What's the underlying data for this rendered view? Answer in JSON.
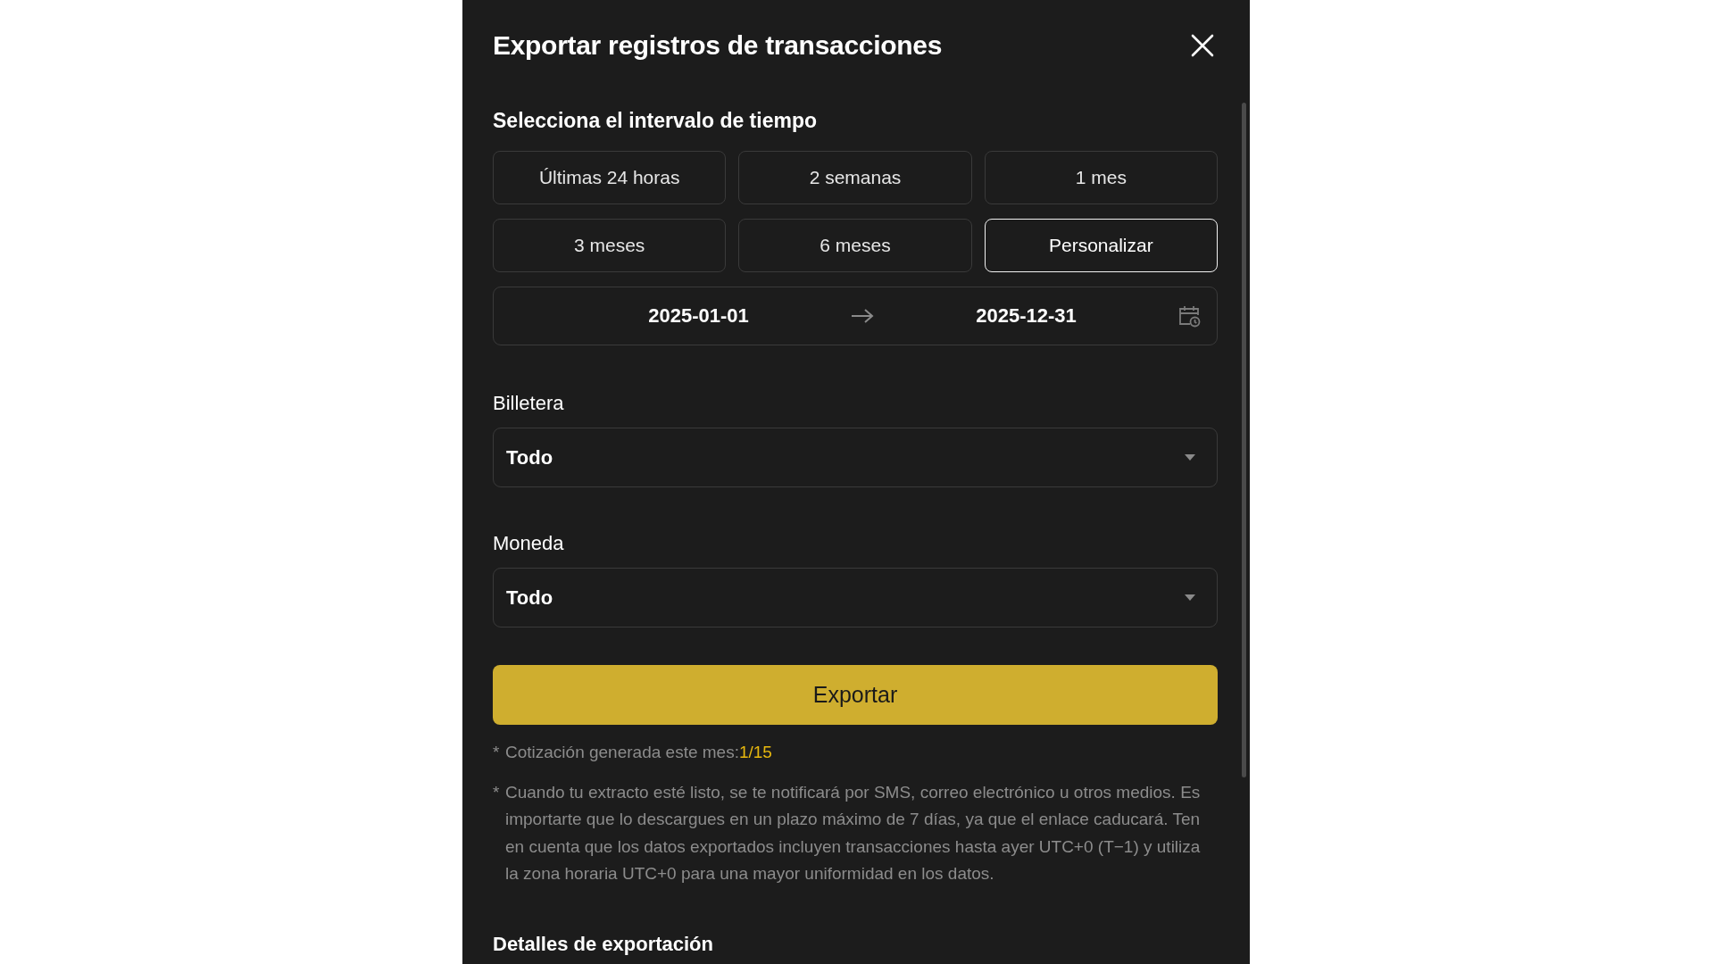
{
  "dialog": {
    "title": "Exportar registros de transacciones"
  },
  "time_range": {
    "label": "Selecciona el intervalo de tiempo",
    "options": [
      {
        "label": "Últimas 24 horas",
        "selected": false
      },
      {
        "label": "2 semanas",
        "selected": false
      },
      {
        "label": "1 mes",
        "selected": false
      },
      {
        "label": "3 meses",
        "selected": false
      },
      {
        "label": "6 meses",
        "selected": false
      },
      {
        "label": "Personalizar",
        "selected": true
      }
    ],
    "start_date": "2025-01-01",
    "end_date": "2025-12-31"
  },
  "fields": [
    {
      "label": "Billetera",
      "value": "Todo"
    },
    {
      "label": "Moneda",
      "value": "Todo"
    }
  ],
  "export_button": "Exportar",
  "notes": [
    {
      "mark": "*",
      "text": "Cotización generada este mes:",
      "highlight": "1/15"
    },
    {
      "mark": "*",
      "text": "Cuando tu extracto esté listo, se te notificará por SMS, correo electrónico u otros medios. Es importarte que lo descargues en un plazo máximo de 7 días, ya que el enlace caducará. Ten en cuenta que los datos exportados incluyen transacciones hasta ayer UTC+0 (T−1) y utiliza la zona horaria UTC+0 para una mayor uniformidad en los datos."
    }
  ],
  "details_heading": "Detalles de exportación"
}
